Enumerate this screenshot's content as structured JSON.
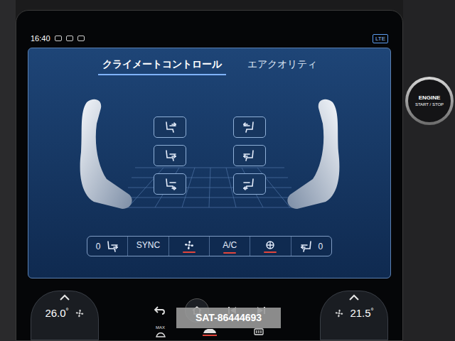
{
  "status_bar": {
    "time": "16:40",
    "network": "LTE"
  },
  "tabs": [
    {
      "label": "クライメートコントロール",
      "selected": true
    },
    {
      "label": "エアクオリティ",
      "selected": false
    }
  ],
  "airflow": {
    "left": [
      {
        "selected": false
      },
      {
        "selected": false
      },
      {
        "selected": false
      }
    ],
    "right": [
      {
        "selected": false
      },
      {
        "selected": false
      },
      {
        "selected": false
      }
    ]
  },
  "climate_bar": [
    {
      "kind": "seat",
      "side": "left",
      "value": "0"
    },
    {
      "kind": "label",
      "label": "SYNC",
      "on": false
    },
    {
      "kind": "fan",
      "on": true
    },
    {
      "kind": "label",
      "label": "A/C",
      "on": true
    },
    {
      "kind": "heat",
      "on": true
    },
    {
      "kind": "seat",
      "side": "right",
      "value": "0"
    }
  ],
  "temps": [
    {
      "value": "26.0",
      "unit": "°"
    },
    {
      "value": "21.5",
      "unit": "°"
    }
  ],
  "bottom_bar": {
    "max_label": "MAX",
    "car_on": true
  },
  "engine_button": {
    "line1": "ENGINE",
    "line2": "START / STOP"
  },
  "watermark": "SAT-86444693"
}
